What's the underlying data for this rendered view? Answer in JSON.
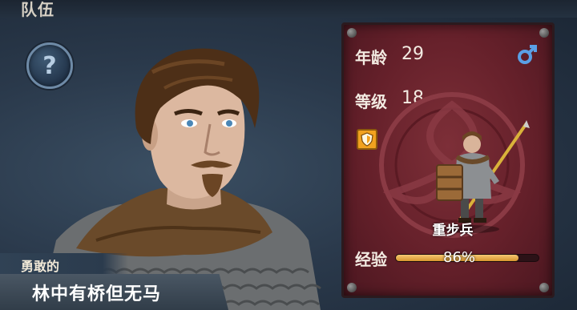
{
  "header": {
    "title": "队伍"
  },
  "help_button": {
    "glyph": "?"
  },
  "hero": {
    "adjective": "勇敢的",
    "name": "林中有桥但无马"
  },
  "stats": {
    "age_label": "年龄",
    "age_value": "29",
    "level_label": "等级",
    "level_value": "18",
    "gender_icon": "male-icon",
    "class_name": "重步兵",
    "exp_label": "经验",
    "exp_percent_text": "86%",
    "exp_fraction": 0.86
  },
  "colors": {
    "card_red": "#65202a",
    "exp_bar": "#e4a844",
    "gender_blue": "#5aa0e6",
    "badge_orange": "#f2a21f"
  }
}
